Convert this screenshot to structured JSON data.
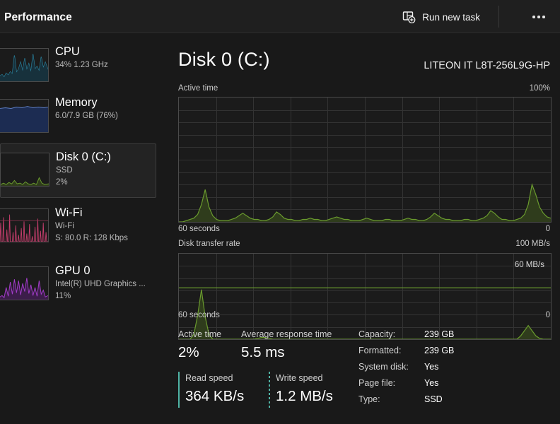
{
  "titlebar": {
    "title": "Performance",
    "run_new_task_label": "Run new task",
    "run_new_task_icon": "new-task-window-plus-icon",
    "more_options_icon": "ellipsis-icon"
  },
  "sidebar": {
    "items": [
      {
        "name": "cpu",
        "title": "CPU",
        "sub1": "34%  1.23 GHz",
        "sub2": "",
        "accent": "#31a2c0",
        "selected": false
      },
      {
        "name": "memory",
        "title": "Memory",
        "sub1": "6.0/7.9 GB (76%)",
        "sub2": "",
        "accent": "#3a63b8",
        "selected": false
      },
      {
        "name": "disk-0",
        "title": "Disk 0 (C:)",
        "sub1": "SSD",
        "sub2": "2%",
        "accent": "#7aa83c",
        "selected": true
      },
      {
        "name": "wifi",
        "title": "Wi-Fi",
        "sub1": "Wi-Fi",
        "sub2": "S: 80.0 R: 128 Kbps",
        "accent": "#d6427a",
        "selected": false
      },
      {
        "name": "gpu-0",
        "title": "GPU 0",
        "sub1": "Intel(R) UHD Graphics ...",
        "sub2": "11%",
        "accent": "#a23cc9",
        "selected": false
      }
    ]
  },
  "main": {
    "title": "Disk 0 (C:)",
    "device": "LITEON IT L8T-256L9G-HP",
    "active_chart": {
      "caption": "Active time",
      "max_label": "100%",
      "x_left_label": "60 seconds",
      "x_right_label": "0"
    },
    "transfer_chart": {
      "caption": "Disk transfer rate",
      "max_label": "100 MB/s",
      "inner_label": "60 MB/s",
      "x_left_label": "60 seconds",
      "x_right_label": "0"
    },
    "stats": {
      "active_time_label": "Active time",
      "active_time_value": "2%",
      "avg_response_label": "Average response time",
      "avg_response_value": "5.5 ms",
      "read_speed_label": "Read speed",
      "read_speed_value": "364 KB/s",
      "write_speed_label": "Write speed",
      "write_speed_value": "1.2 MB/s"
    },
    "info": [
      {
        "key": "Capacity:",
        "value": "239 GB"
      },
      {
        "key": "Formatted:",
        "value": "239 GB"
      },
      {
        "key": "System disk:",
        "value": "Yes"
      },
      {
        "key": "Page file:",
        "value": "Yes"
      },
      {
        "key": "Type:",
        "value": "SSD"
      }
    ]
  },
  "chart_data": [
    {
      "type": "area",
      "title": "Active time",
      "ylabel": "Active time",
      "xlabel": "60 seconds",
      "ylim": [
        0,
        100
      ],
      "xlim": [
        60,
        0
      ],
      "grid": true,
      "line_color": "#6a9b2e",
      "fill_color": "#2f3c1c",
      "values": [
        0,
        0,
        1,
        2,
        3,
        6,
        14,
        26,
        12,
        5,
        2,
        1,
        1,
        1,
        2,
        3,
        5,
        7,
        5,
        3,
        2,
        2,
        1,
        1,
        2,
        4,
        8,
        6,
        3,
        2,
        2,
        1,
        1,
        2,
        2,
        3,
        2,
        2,
        1,
        1,
        2,
        3,
        4,
        3,
        2,
        2,
        1,
        1,
        1,
        2,
        3,
        2,
        1,
        1,
        1,
        2,
        2,
        1,
        1,
        1,
        2,
        3,
        2,
        2,
        1,
        1,
        2,
        4,
        7,
        5,
        3,
        2,
        2,
        1,
        1,
        1,
        2,
        2,
        1,
        1,
        2,
        3,
        5,
        9,
        7,
        4,
        2,
        2,
        1,
        1,
        2,
        3,
        6,
        14,
        30,
        22,
        12,
        7,
        4,
        3
      ]
    },
    {
      "type": "area",
      "title": "Disk transfer rate",
      "ylabel": "Disk transfer rate",
      "xlabel": "60 seconds",
      "ylim": [
        0,
        100
      ],
      "xlim": [
        60,
        0
      ],
      "grid": true,
      "reference_line": 60,
      "line_color": "#6a9b2e",
      "fill_color": "#2f3c1c",
      "values": [
        0,
        0,
        0,
        0,
        6,
        28,
        58,
        26,
        6,
        0,
        0,
        0,
        0,
        0,
        0,
        0,
        0,
        0,
        0,
        0,
        0,
        1,
        2,
        2,
        1,
        0,
        0,
        0,
        0,
        0,
        0,
        0,
        0,
        0,
        0,
        0,
        0,
        0,
        0,
        0,
        0,
        0,
        0,
        0,
        0,
        0,
        0,
        0,
        0,
        0,
        0,
        0,
        0,
        0,
        0,
        0,
        0,
        0,
        0,
        0,
        0,
        0,
        0,
        0,
        0,
        0,
        0,
        0,
        0,
        0,
        0,
        0,
        0,
        0,
        0,
        0,
        0,
        0,
        0,
        0,
        0,
        0,
        0,
        0,
        0,
        0,
        0,
        0,
        0,
        0,
        0,
        4,
        10,
        16,
        10,
        4,
        1,
        0,
        0,
        0
      ]
    }
  ]
}
